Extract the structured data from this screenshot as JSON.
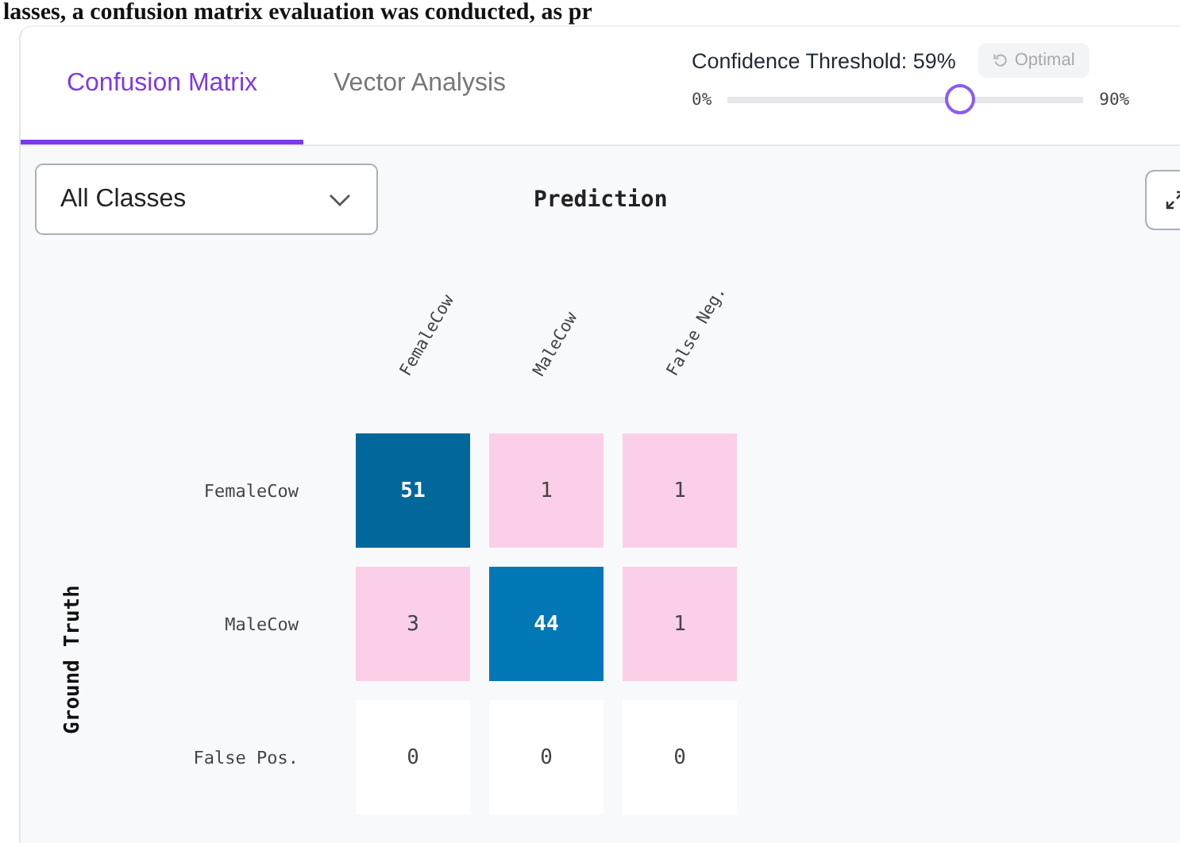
{
  "document_text": "lasses, a confusion matrix evaluation was conducted, as pr",
  "tabs": [
    {
      "label": "Confusion Matrix",
      "selected": true
    },
    {
      "label": "Vector Analysis",
      "selected": false
    }
  ],
  "threshold": {
    "label": "Confidence Threshold: 59%",
    "reset_button": "Optimal",
    "min": "0%",
    "max": "90%",
    "level": 0.656
  },
  "class_filter": {
    "value": "All Classes"
  },
  "matrix": {
    "x_axis": "Prediction",
    "y_axis": "Ground Truth",
    "columns": [
      "FemaleCow",
      "MaleCow",
      "False Neg."
    ],
    "rows": [
      {
        "label": "FemaleCow",
        "cells": [
          {
            "value": "51",
            "color": "#02679b"
          },
          {
            "value": "1",
            "color": "#fbcfe8"
          },
          {
            "value": "1",
            "color": "#fbcfe8"
          }
        ]
      },
      {
        "label": "MaleCow",
        "cells": [
          {
            "value": "3",
            "color": "#fbcfe8"
          },
          {
            "value": "44",
            "color": "#0277b6"
          },
          {
            "value": "1",
            "color": "#fbcfe8"
          }
        ]
      },
      {
        "label": "False Pos.",
        "cells": [
          {
            "value": "0",
            "color": "#ffffff"
          },
          {
            "value": "0",
            "color": "#ffffff"
          },
          {
            "value": "0",
            "color": "#ffffff"
          }
        ]
      }
    ]
  }
}
